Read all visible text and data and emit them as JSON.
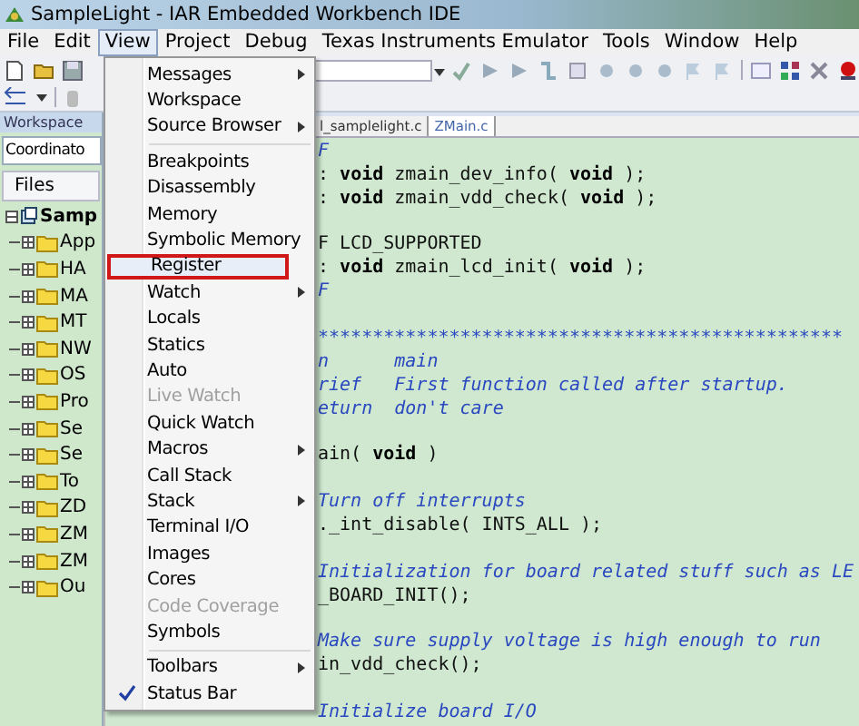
{
  "window": {
    "title": "SampleLight - IAR Embedded Workbench IDE"
  },
  "menu_bar": [
    {
      "label": "File",
      "selected": false
    },
    {
      "label": "Edit",
      "selected": false
    },
    {
      "label": "View",
      "selected": true
    },
    {
      "label": "Project",
      "selected": false
    },
    {
      "label": "Debug",
      "selected": false
    },
    {
      "label": "Texas Instruments Emulator",
      "selected": false
    },
    {
      "label": "Tools",
      "selected": false
    },
    {
      "label": "Window",
      "selected": false
    },
    {
      "label": "Help",
      "selected": false
    }
  ],
  "workspace": {
    "title": "Workspace",
    "configuration": "Coordinato",
    "files_header": "Files",
    "tree": [
      {
        "label": "Samp",
        "expanded": true,
        "children": [
          {
            "label": "App"
          },
          {
            "label": "HA"
          },
          {
            "label": "MA"
          },
          {
            "label": "MT"
          },
          {
            "label": "NW"
          },
          {
            "label": "OS"
          },
          {
            "label": "Pro"
          },
          {
            "label": "Se"
          },
          {
            "label": "Se"
          },
          {
            "label": "To"
          },
          {
            "label": "ZD"
          },
          {
            "label": "ZM"
          },
          {
            "label": "ZM"
          },
          {
            "label": "Ou"
          }
        ]
      }
    ]
  },
  "view_menu": [
    {
      "kind": "item",
      "label": "Messages",
      "submenu": true,
      "disabled": false,
      "checked": false,
      "selected": false
    },
    {
      "kind": "item",
      "label": "Workspace",
      "submenu": false,
      "disabled": false,
      "checked": false,
      "selected": false
    },
    {
      "kind": "item",
      "label": "Source Browser",
      "submenu": true,
      "disabled": false,
      "checked": false,
      "selected": false
    },
    {
      "kind": "separator"
    },
    {
      "kind": "item",
      "label": "Breakpoints",
      "submenu": false,
      "disabled": false,
      "checked": false,
      "selected": false
    },
    {
      "kind": "item",
      "label": "Disassembly",
      "submenu": false,
      "disabled": false,
      "checked": false,
      "selected": false
    },
    {
      "kind": "item",
      "label": "Memory",
      "submenu": false,
      "disabled": false,
      "checked": false,
      "selected": false
    },
    {
      "kind": "item",
      "label": "Symbolic Memory",
      "submenu": false,
      "disabled": false,
      "checked": false,
      "selected": false
    },
    {
      "kind": "item",
      "label": "Register",
      "submenu": false,
      "disabled": false,
      "checked": false,
      "selected": true
    },
    {
      "kind": "item",
      "label": "Watch",
      "submenu": true,
      "disabled": false,
      "checked": false,
      "selected": false
    },
    {
      "kind": "item",
      "label": "Locals",
      "submenu": false,
      "disabled": false,
      "checked": false,
      "selected": false
    },
    {
      "kind": "item",
      "label": "Statics",
      "submenu": false,
      "disabled": false,
      "checked": false,
      "selected": false
    },
    {
      "kind": "item",
      "label": "Auto",
      "submenu": false,
      "disabled": false,
      "checked": false,
      "selected": false
    },
    {
      "kind": "item",
      "label": "Live Watch",
      "submenu": false,
      "disabled": true,
      "checked": false,
      "selected": false
    },
    {
      "kind": "item",
      "label": "Quick Watch",
      "submenu": false,
      "disabled": false,
      "checked": false,
      "selected": false
    },
    {
      "kind": "item",
      "label": "Macros",
      "submenu": true,
      "disabled": false,
      "checked": false,
      "selected": false
    },
    {
      "kind": "item",
      "label": "Call Stack",
      "submenu": false,
      "disabled": false,
      "checked": false,
      "selected": false
    },
    {
      "kind": "item",
      "label": "Stack",
      "submenu": true,
      "disabled": false,
      "checked": false,
      "selected": false
    },
    {
      "kind": "item",
      "label": "Terminal I/O",
      "submenu": false,
      "disabled": false,
      "checked": false,
      "selected": false
    },
    {
      "kind": "item",
      "label": "Images",
      "submenu": false,
      "disabled": false,
      "checked": false,
      "selected": false
    },
    {
      "kind": "item",
      "label": "Cores",
      "submenu": false,
      "disabled": false,
      "checked": false,
      "selected": false
    },
    {
      "kind": "item",
      "label": "Code Coverage",
      "submenu": false,
      "disabled": true,
      "checked": false,
      "selected": false
    },
    {
      "kind": "item",
      "label": "Symbols",
      "submenu": false,
      "disabled": false,
      "checked": false,
      "selected": false
    },
    {
      "kind": "separator"
    },
    {
      "kind": "item",
      "label": "Toolbars",
      "submenu": true,
      "disabled": false,
      "checked": false,
      "selected": false
    },
    {
      "kind": "item",
      "label": "Status Bar",
      "submenu": false,
      "disabled": false,
      "checked": true,
      "selected": false
    }
  ],
  "editor": {
    "tabs": [
      {
        "label": "l_samplelight.c",
        "selected": false
      },
      {
        "label": "ZMain.c",
        "selected": true
      }
    ],
    "lines": [
      {
        "kind": "code",
        "segments": [
          {
            "kind": "comment",
            "text": "F"
          }
        ]
      },
      {
        "kind": "code",
        "segments": [
          {
            "kind": "plain",
            "text": ": "
          },
          {
            "kind": "keyword",
            "text": "void"
          },
          {
            "kind": "plain",
            "text": " zmain_dev_info( "
          },
          {
            "kind": "keyword",
            "text": "void"
          },
          {
            "kind": "plain",
            "text": " );"
          }
        ]
      },
      {
        "kind": "code",
        "segments": [
          {
            "kind": "plain",
            "text": ": "
          },
          {
            "kind": "keyword",
            "text": "void"
          },
          {
            "kind": "plain",
            "text": " zmain_vdd_check( "
          },
          {
            "kind": "keyword",
            "text": "void"
          },
          {
            "kind": "plain",
            "text": " );"
          }
        ]
      },
      {
        "kind": "blank"
      },
      {
        "kind": "code",
        "segments": [
          {
            "kind": "plain",
            "text": "F LCD_SUPPORTED"
          }
        ]
      },
      {
        "kind": "code",
        "segments": [
          {
            "kind": "plain",
            "text": ": "
          },
          {
            "kind": "keyword",
            "text": "void"
          },
          {
            "kind": "plain",
            "text": " zmain_lcd_init( "
          },
          {
            "kind": "keyword",
            "text": "void"
          },
          {
            "kind": "plain",
            "text": " );"
          }
        ]
      },
      {
        "kind": "code",
        "segments": [
          {
            "kind": "comment",
            "text": "F"
          }
        ]
      },
      {
        "kind": "blank"
      },
      {
        "kind": "code",
        "segments": [
          {
            "kind": "comment",
            "text": "************************************************"
          }
        ]
      },
      {
        "kind": "code",
        "segments": [
          {
            "kind": "comment",
            "text": "n      main"
          }
        ]
      },
      {
        "kind": "code",
        "segments": [
          {
            "kind": "comment",
            "text": "rief   First function called after startup."
          }
        ]
      },
      {
        "kind": "code",
        "segments": [
          {
            "kind": "comment",
            "text": "eturn  don't care"
          }
        ]
      },
      {
        "kind": "blank"
      },
      {
        "kind": "code",
        "segments": [
          {
            "kind": "plain",
            "text": "ain( "
          },
          {
            "kind": "keyword",
            "text": "void"
          },
          {
            "kind": "plain",
            "text": " )"
          }
        ]
      },
      {
        "kind": "blank"
      },
      {
        "kind": "code",
        "segments": [
          {
            "kind": "comment",
            "text": "Turn off interrupts"
          }
        ]
      },
      {
        "kind": "code",
        "segments": [
          {
            "kind": "plain",
            "text": "._int_disable( INTS_ALL );"
          }
        ]
      },
      {
        "kind": "blank"
      },
      {
        "kind": "code",
        "segments": [
          {
            "kind": "comment",
            "text": "Initialization for board related stuff such as LE"
          }
        ]
      },
      {
        "kind": "code",
        "segments": [
          {
            "kind": "plain",
            "text": "_BOARD_INIT();"
          }
        ]
      },
      {
        "kind": "blank"
      },
      {
        "kind": "code",
        "segments": [
          {
            "kind": "comment",
            "text": "Make sure supply voltage is high enough to run"
          }
        ]
      },
      {
        "kind": "code",
        "segments": [
          {
            "kind": "plain",
            "text": "in_vdd_check();"
          }
        ]
      },
      {
        "kind": "blank"
      },
      {
        "kind": "code",
        "segments": [
          {
            "kind": "comment",
            "text": "Initialize board I/O"
          }
        ]
      }
    ]
  }
}
